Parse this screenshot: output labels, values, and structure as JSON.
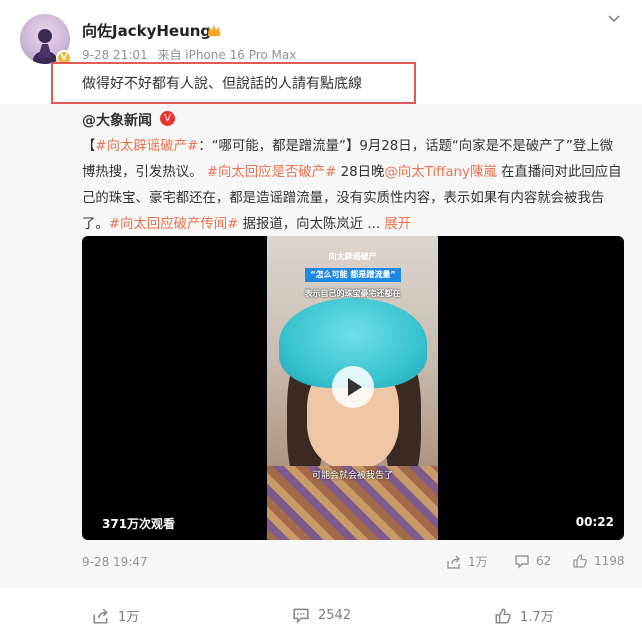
{
  "post": {
    "username": "向佐JackyHeung",
    "date": "9-28 21:01",
    "source": "来自 iPhone 16 Pro Max",
    "text": "做得好不好都有人說、但說話的人請有點底線"
  },
  "repost": {
    "author": "@大象新闻",
    "body": {
      "p1": "【",
      "tag1": "#向太辟谣破产#",
      "p2": "：“哪可能，都是蹭流量”】9月28日，话题“向家是不是破产了”登上微博热搜，引发热议。",
      "tag2": "#向太回应是否破产#",
      "p3": " 28日晚",
      "mention": "@向太Tiffany陳嵐",
      "p4": " 在直播间对此回应自己的珠宝、豪宅都还在，都是造谣蹭流量，没有实质性内容，表示如果有内容就会被我告了。",
      "tag3": "#向太回应破产传闻#",
      "p5": " 据报道，向太陈岚近 ... ",
      "more": "展开"
    },
    "video": {
      "caption_title": "向太辟谣破产",
      "caption_box": "“怎么可能 都是蹭流量”",
      "caption_sub": "表示自己的珠宝豪宅还都在",
      "caption_bottom": "可能会就会被我告了",
      "views": "371万次观看",
      "duration": "00:22"
    },
    "date": "9-28 19:47",
    "actions": {
      "share": "1万",
      "comment": "62",
      "like": "1198"
    }
  },
  "footer": {
    "share": "1万",
    "comment": "2542",
    "like": "1.7万"
  }
}
